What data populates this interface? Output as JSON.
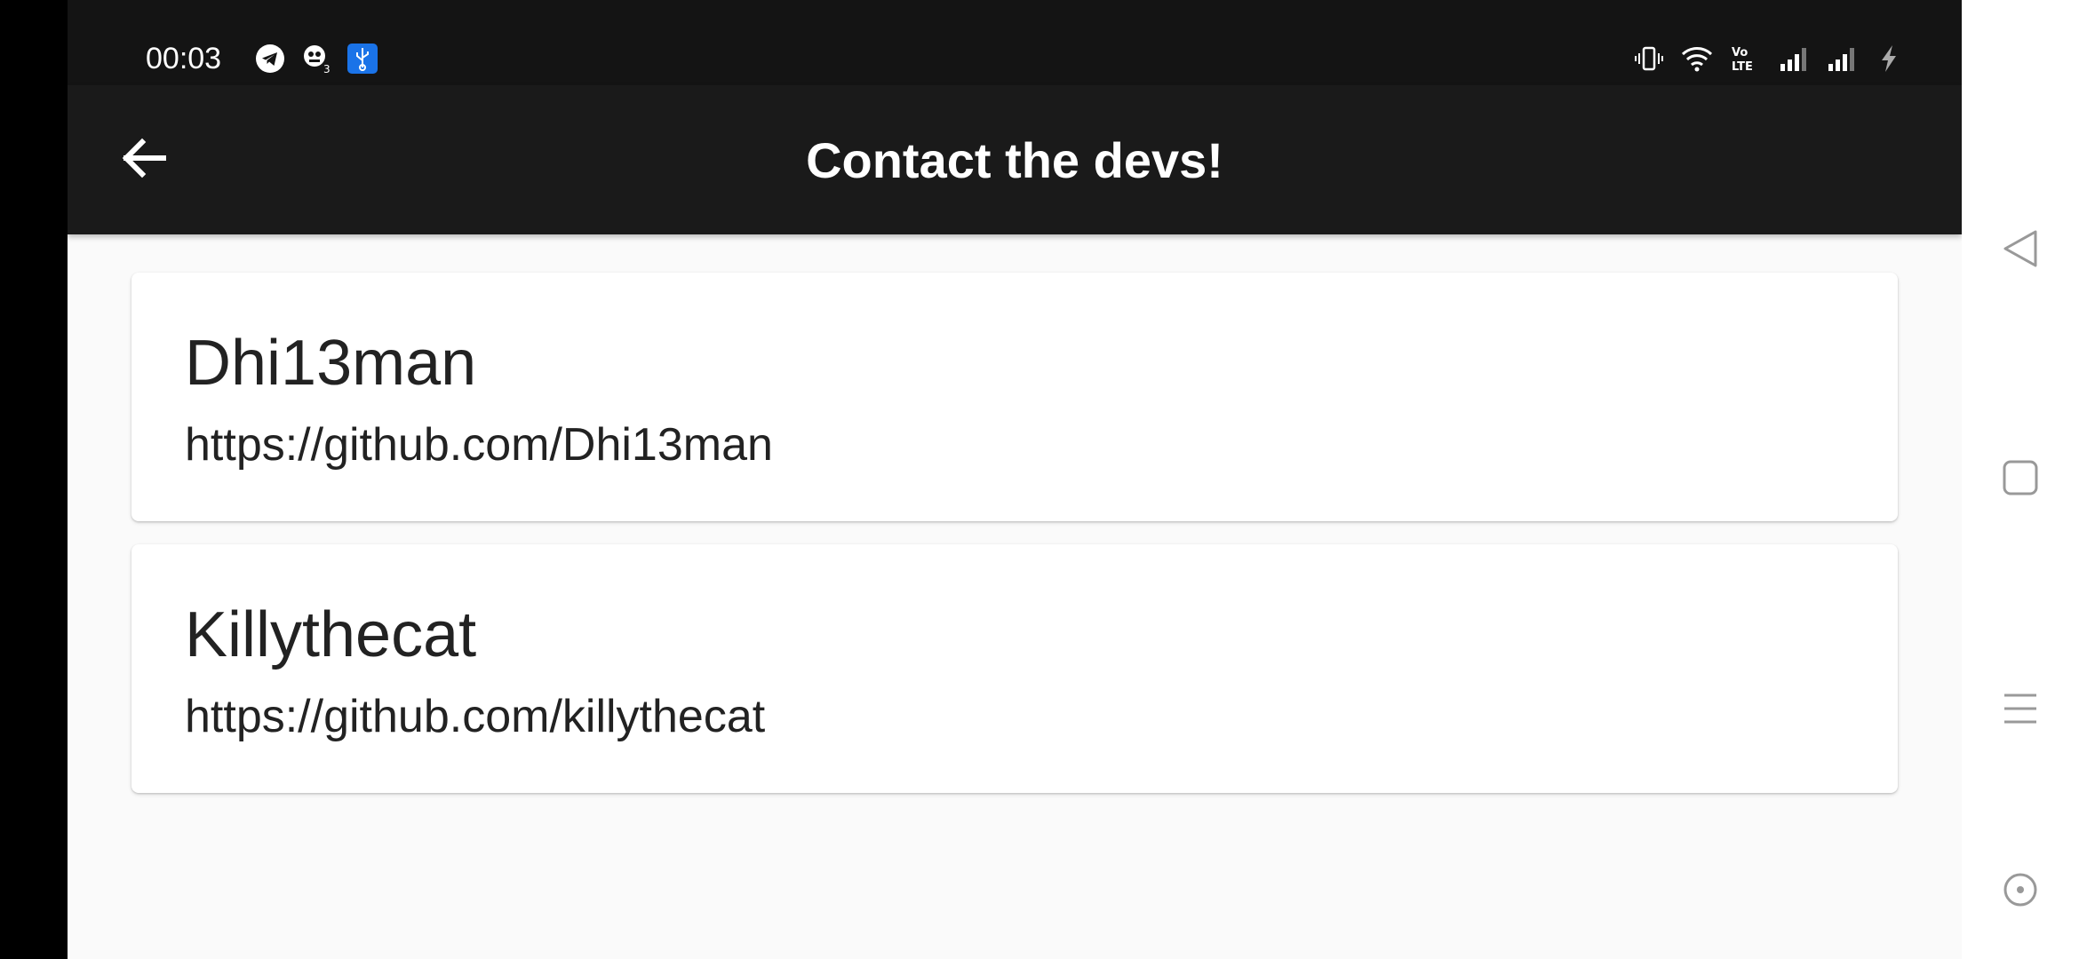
{
  "status_bar": {
    "time": "00:03",
    "left_icons": [
      "telegram-icon",
      "notification-badge-icon",
      "usb-icon"
    ],
    "right_icons": [
      "vibrate-icon",
      "wifi-icon",
      "volte-icon",
      "signal-icon-1",
      "signal-icon-2",
      "charging-icon"
    ],
    "volte_label": "Vo\nLTE"
  },
  "app_bar": {
    "title": "Contact the devs!",
    "back_icon": "arrow-back-icon"
  },
  "contacts": [
    {
      "name": "Dhi13man",
      "url": "https://github.com/Dhi13man"
    },
    {
      "name": "Killythecat",
      "url": "https://github.com/killythecat"
    }
  ],
  "nav_bar": {
    "icons": [
      "nav-back-icon",
      "nav-home-icon",
      "nav-recents-icon",
      "assist-icon"
    ]
  },
  "colors": {
    "app_bar": "#1a1a1a",
    "status_bar": "#141414",
    "background": "#fafafa",
    "card": "#ffffff",
    "text": "#222222"
  }
}
